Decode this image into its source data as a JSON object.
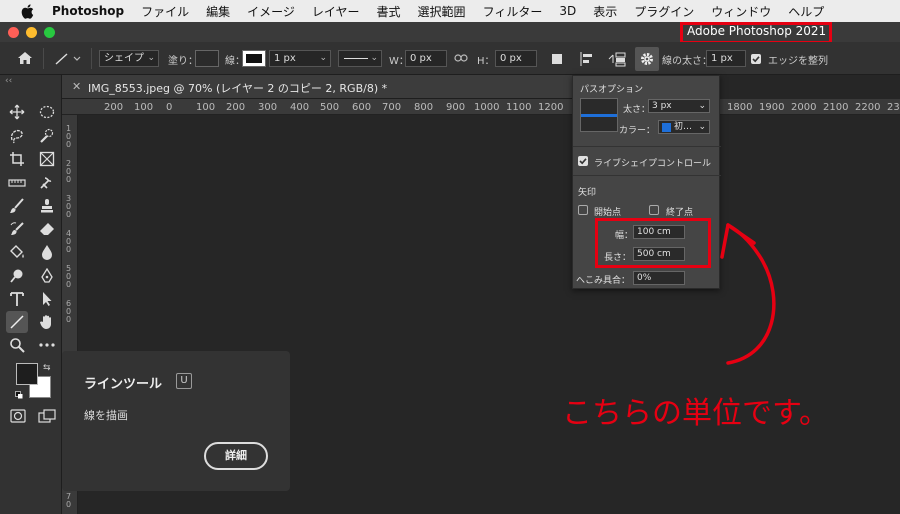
{
  "menubar": {
    "app_name": "Photoshop",
    "items": [
      "ファイル",
      "編集",
      "イメージ",
      "レイヤー",
      "書式",
      "選択範囲",
      "フィルター",
      "3D",
      "表示",
      "プラグイン",
      "ウィンドウ",
      "ヘルプ"
    ]
  },
  "window": {
    "title": "Adobe Photoshop 2021"
  },
  "options_bar": {
    "mode": "シェイプ",
    "fill_label": "塗り：",
    "stroke_label": "線：",
    "stroke_width": "1 px",
    "w_label": "W：",
    "w_value": "0 px",
    "h_label": "H：",
    "h_value": "0 px",
    "line_weight_label": "線の太さ：",
    "line_weight_value": "1 px",
    "align_edges_label": "エッジを整列",
    "align_edges_checked": true
  },
  "document_tab": {
    "title": "IMG_8553.jpeg @ 70% (レイヤー 2 のコピー 2, RGB/8) *"
  },
  "ruler": {
    "h_ticks": [
      "200",
      "100",
      "0",
      "100",
      "200",
      "300",
      "400",
      "500",
      "600",
      "700",
      "800",
      "900",
      "1000",
      "1100",
      "1200",
      "1800",
      "1900",
      "2000",
      "2100",
      "2200",
      "23"
    ],
    "v_ticks": [
      "1\n0\n0",
      "2\n0\n0",
      "3\n0\n0",
      "4\n0\n0",
      "5\n0\n0",
      "6\n0\n0",
      "7\n0"
    ]
  },
  "path_options": {
    "title": "パスオプション",
    "weight_label": "太さ：",
    "weight_value": "3 px",
    "color_label": "カラー：",
    "color_value": "初…",
    "color_swatch": "#1e6fd9",
    "live_shape_label": "ライブシェイプコントロール",
    "live_shape_checked": true,
    "arrow_section": "矢印",
    "start_label": "開始点",
    "end_label": "終了点",
    "width_label": "幅：",
    "width_value": "100 cm",
    "length_label": "長さ：",
    "length_value": "500 cm",
    "concavity_label": "へこみ具合：",
    "concavity_value": "0%"
  },
  "tooltip": {
    "title": "ラインツール",
    "shortcut": "U",
    "description": "線を描画",
    "details_button": "詳細"
  },
  "annotation": {
    "text": "こちらの単位です。",
    "color": "#e60012"
  },
  "colors": {
    "foreground": "#1e1e1e",
    "background": "#ffffff",
    "accent_red": "#e60012"
  }
}
